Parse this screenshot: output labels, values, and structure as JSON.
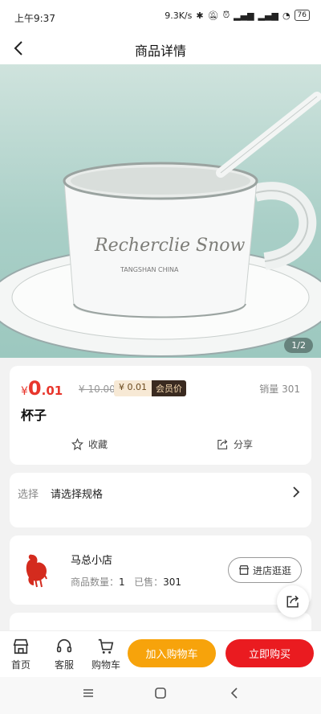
{
  "status_bar": {
    "time": "上午9:37",
    "speed": "9.3K/s",
    "battery": "76"
  },
  "header": {
    "title": "商品详情"
  },
  "gallery": {
    "counter": "1/2",
    "cup_brand": "Recherclie Snow",
    "cup_sub": "TANGSHAN CHINA"
  },
  "product": {
    "currency": "¥",
    "price_int": "0",
    "price_dec": ".01",
    "original_price": "¥ 10.00",
    "member_price": "¥ 0.01",
    "member_tag": "会员价",
    "sales": "销量 301",
    "name": "杯子",
    "favorite_label": "收藏",
    "share_label": "分享"
  },
  "spec": {
    "label": "选择",
    "value": "请选择规格"
  },
  "shop": {
    "name": "马总小店",
    "count_label": "商品数量：",
    "count_value": "1",
    "sold_label": "已售：",
    "sold_value": "301",
    "enter_label": "进店逛逛"
  },
  "bottom_bar": {
    "home_label": "首页",
    "service_label": "客服",
    "cart_label": "购物车",
    "add_cart_label": "加入购物车",
    "buy_now_label": "立即购买"
  },
  "colors": {
    "price_red": "#e8362c",
    "add_cart": "#f7a30b",
    "buy_now": "#ea1b20"
  }
}
